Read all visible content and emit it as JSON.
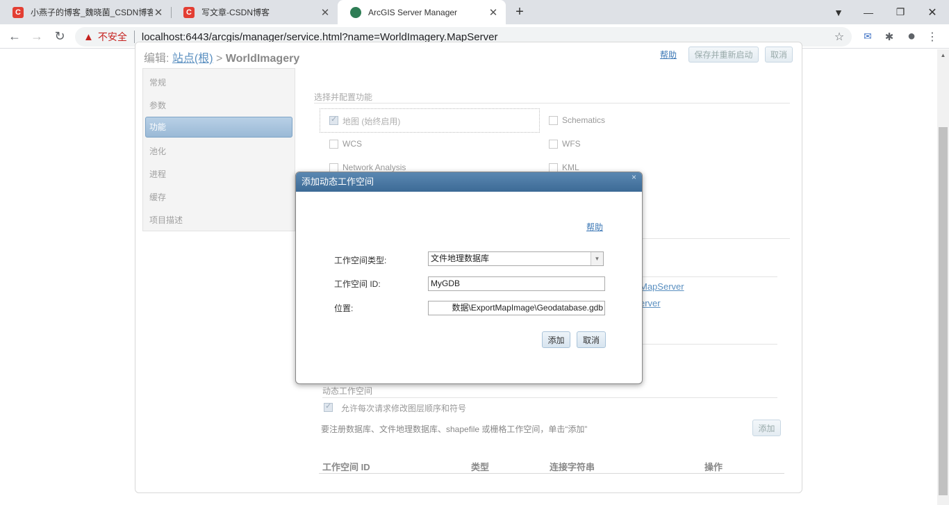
{
  "browser": {
    "tabs": [
      {
        "title": "小燕子的博客_魏晓菌_CSDN博客",
        "icon": "csdn-icon",
        "fav": "C"
      },
      {
        "title": "写文章-CSDN博客",
        "icon": "csdn-icon",
        "fav": "C"
      },
      {
        "title": "ArcGIS Server Manager",
        "icon": "globe-icon",
        "fav": ""
      }
    ],
    "security": "不安全",
    "url": "localhost:6443/arcgis/manager/service.html?name=WorldImagery.MapServer"
  },
  "page": {
    "breadcrumb_prefix": "编辑:",
    "breadcrumb_link": "站点(根)",
    "breadcrumb_sep": ">",
    "breadcrumb_current": "WorldImagery",
    "help": "帮助",
    "save_restart": "保存并重新启动",
    "cancel": "取消",
    "nav": [
      "常规",
      "参数",
      "功能",
      "池化",
      "进程",
      "缓存",
      "项目描述"
    ],
    "nav_active": "功能",
    "capabilities_header": "选择并配置功能",
    "capabilities": [
      {
        "label": "地图 (始终启用)",
        "checked": true
      },
      {
        "label": "Schematics",
        "checked": false
      },
      {
        "label": "WCS",
        "checked": false
      },
      {
        "label": "WFS",
        "checked": false
      },
      {
        "label": "Network Analysis",
        "checked": false
      },
      {
        "label": "KML",
        "checked": false
      }
    ],
    "behind_link_1": "MapServer",
    "behind_link_2": "erver",
    "dynamic_header": "动态工作空间",
    "allow_label": "允许每次请求修改图层顺序和符号",
    "register_hint": "要注册数据库、文件地理数据库、shapefile 或栅格工作空间，单击“添加”",
    "add": "添加",
    "table_headers": [
      "工作空间 ID",
      "类型",
      "连接字符串",
      "操作"
    ]
  },
  "modal": {
    "title": "添加动态工作空间",
    "close": "×",
    "help": "帮助",
    "type_label": "工作空间类型:",
    "type_value": "文件地理数据库",
    "id_label": "工作空间 ID:",
    "id_value": "MyGDB",
    "location_label": "位置:",
    "location_value": "数据\\ExportMapImage\\Geodatabase.gdb",
    "add": "添加",
    "cancel": "取消"
  },
  "colors": {
    "header": "#3c6a96",
    "accent": "#9ab9d6",
    "link": "#3b77b5"
  }
}
